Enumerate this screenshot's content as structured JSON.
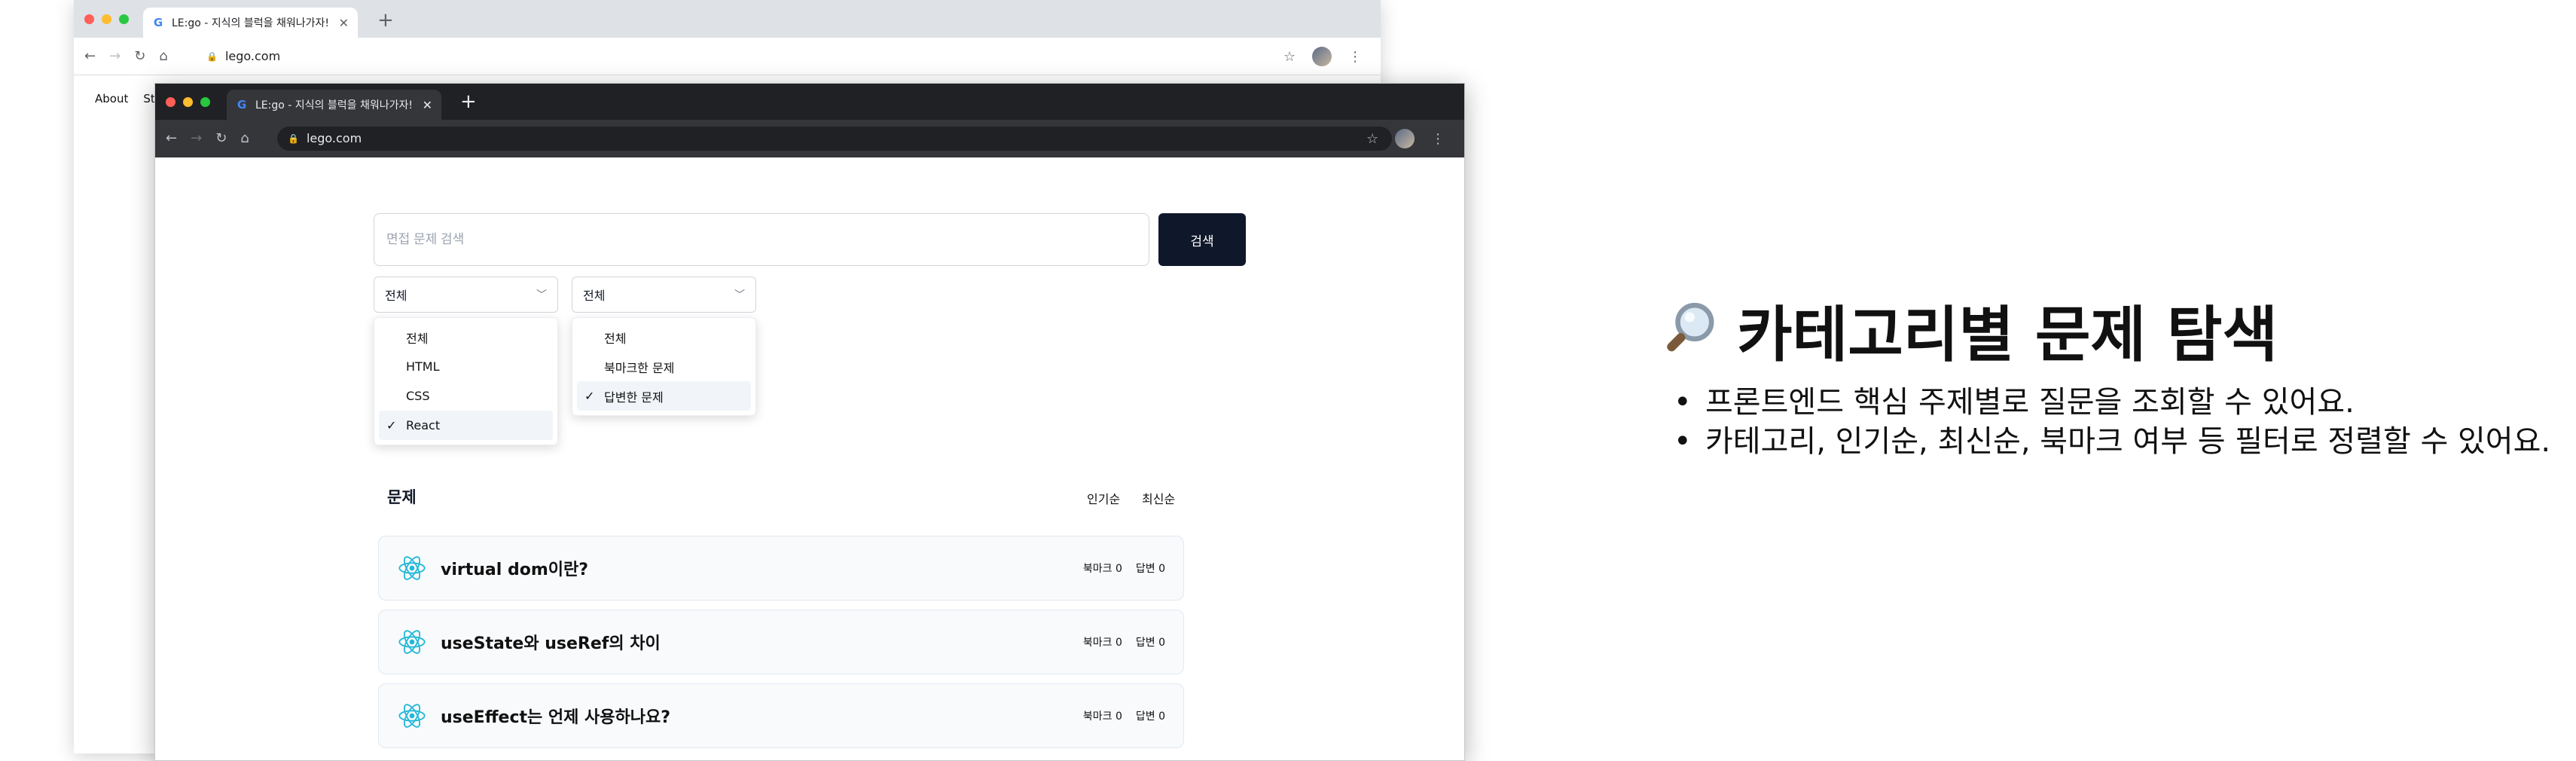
{
  "back_browser": {
    "tab_title": "LE:go - 지식의 블럭을 채워나가자!",
    "url": "lego.com",
    "page_links": [
      "About",
      "St"
    ]
  },
  "front_browser": {
    "tab_title": "LE:go - 지식의 블럭을 채워나가자!",
    "url": "lego.com"
  },
  "search": {
    "placeholder": "면접 문제 검색",
    "button_label": "검색"
  },
  "category_select": {
    "value": "전체",
    "options": [
      "전체",
      "HTML",
      "CSS",
      "React"
    ],
    "checked": "React"
  },
  "filter_select": {
    "value": "전체",
    "options": [
      "전체",
      "북마크한 문제",
      "답변한 문제"
    ],
    "checked": "답변한 문제"
  },
  "questions_section": {
    "title": "문제",
    "sort_popular": "인기순",
    "sort_latest": "최신순",
    "items": [
      {
        "title": "virtual dom이란?",
        "bookmarks": "북마크 0",
        "answers": "답변 0"
      },
      {
        "title": "useState와 useRef의 차이",
        "bookmarks": "북마크 0",
        "answers": "답변 0"
      },
      {
        "title": "useEffect는 언제 사용하나요?",
        "bookmarks": "북마크 0",
        "answers": "답변 0"
      }
    ]
  },
  "description": {
    "title": "카테고리별 문제 탐색",
    "bullets": [
      "프론트엔드 핵심 주제별로 질문을 조회할 수 있어요.",
      "카테고리, 인기순, 최신순, 북마크 여부 등 필터로 정렬할 수 있어요."
    ]
  },
  "colors": {
    "search_button": "#0f172a",
    "react_icon": "#22b8d8",
    "dark_chrome": "#202124"
  },
  "icons": [
    "google-icon",
    "close-icon",
    "plus-icon",
    "back-icon",
    "forward-icon",
    "reload-icon",
    "home-icon",
    "lock-icon",
    "star-icon",
    "more-icon",
    "chevron-down-icon",
    "check-icon",
    "react-icon",
    "magnifier-icon"
  ]
}
